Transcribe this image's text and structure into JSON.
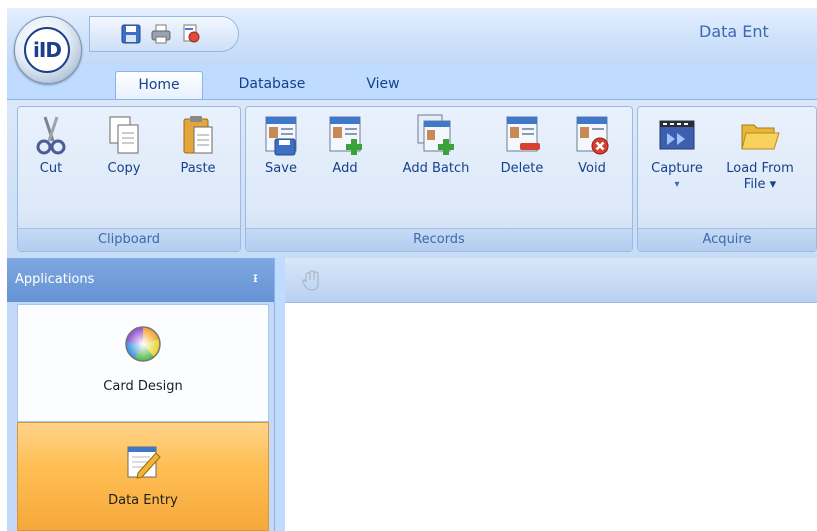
{
  "window": {
    "title": "Data Ent"
  },
  "app_orb": {
    "logo_text": "iID"
  },
  "quick_access": [
    {
      "icon": "save-icon"
    },
    {
      "icon": "print-icon"
    },
    {
      "icon": "print-preview-icon"
    }
  ],
  "tabs": [
    {
      "label": "Home",
      "active": true
    },
    {
      "label": "Database",
      "active": false
    },
    {
      "label": "View",
      "active": false
    }
  ],
  "ribbon": {
    "groups": [
      {
        "label": "Clipboard",
        "buttons": [
          {
            "label": "Cut",
            "icon": "scissors-icon"
          },
          {
            "label": "Copy",
            "icon": "copy-icon"
          },
          {
            "label": "Paste",
            "icon": "paste-icon"
          }
        ]
      },
      {
        "label": "Records",
        "buttons": [
          {
            "label": "Save",
            "icon": "save-record-icon"
          },
          {
            "label": "Add",
            "icon": "add-record-icon"
          },
          {
            "label": "Add Batch",
            "icon": "add-batch-icon"
          },
          {
            "label": "Delete",
            "icon": "delete-record-icon"
          },
          {
            "label": "Void",
            "icon": "void-record-icon"
          }
        ]
      },
      {
        "label": "Acquire",
        "buttons": [
          {
            "label": "Capture",
            "label2": "▾",
            "icon": "capture-icon"
          },
          {
            "label": "Load From",
            "label2": "File ▾",
            "icon": "folder-open-icon"
          }
        ]
      }
    ]
  },
  "panel": {
    "title": "Applications",
    "pin": "ᵻ",
    "items": [
      {
        "label": "Card Design",
        "icon": "color-wheel-icon",
        "selected": false
      },
      {
        "label": "Data Entry",
        "icon": "notepad-pencil-icon",
        "selected": true
      }
    ]
  },
  "colors": {
    "ribbon_bg": "#c7dcf6",
    "panel_header": "#6f9bd8",
    "selected_item": "#ffbf55",
    "text": "#15428b"
  }
}
